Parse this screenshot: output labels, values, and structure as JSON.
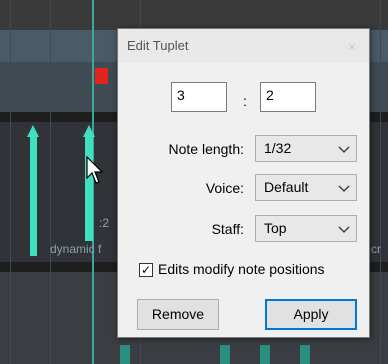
{
  "background": {
    "tuplet_label": ":2",
    "lane_text": "dynamic f",
    "lane_text_right": "cr"
  },
  "dialog": {
    "title": "Edit Tuplet",
    "close_symbol": "×",
    "numerator": "3",
    "separator": ":",
    "denominator": "2",
    "note_length_label": "Note length:",
    "note_length_value": "1/32",
    "voice_label": "Voice:",
    "voice_value": "Default",
    "staff_label": "Staff:",
    "staff_value": "Top",
    "checkbox_checked": true,
    "checkbox_label": "Edits modify note positions",
    "remove_label": "Remove",
    "apply_label": "Apply"
  },
  "icons": {
    "dropdown": "chevron-down-icon",
    "cursor": "mouse-pointer-icon",
    "check": "✓"
  },
  "colors": {
    "note_stem": "#3ee0c0",
    "cursor_line": "#3aa89a",
    "marker": "#e0261c",
    "apply_border": "#0078d7"
  }
}
